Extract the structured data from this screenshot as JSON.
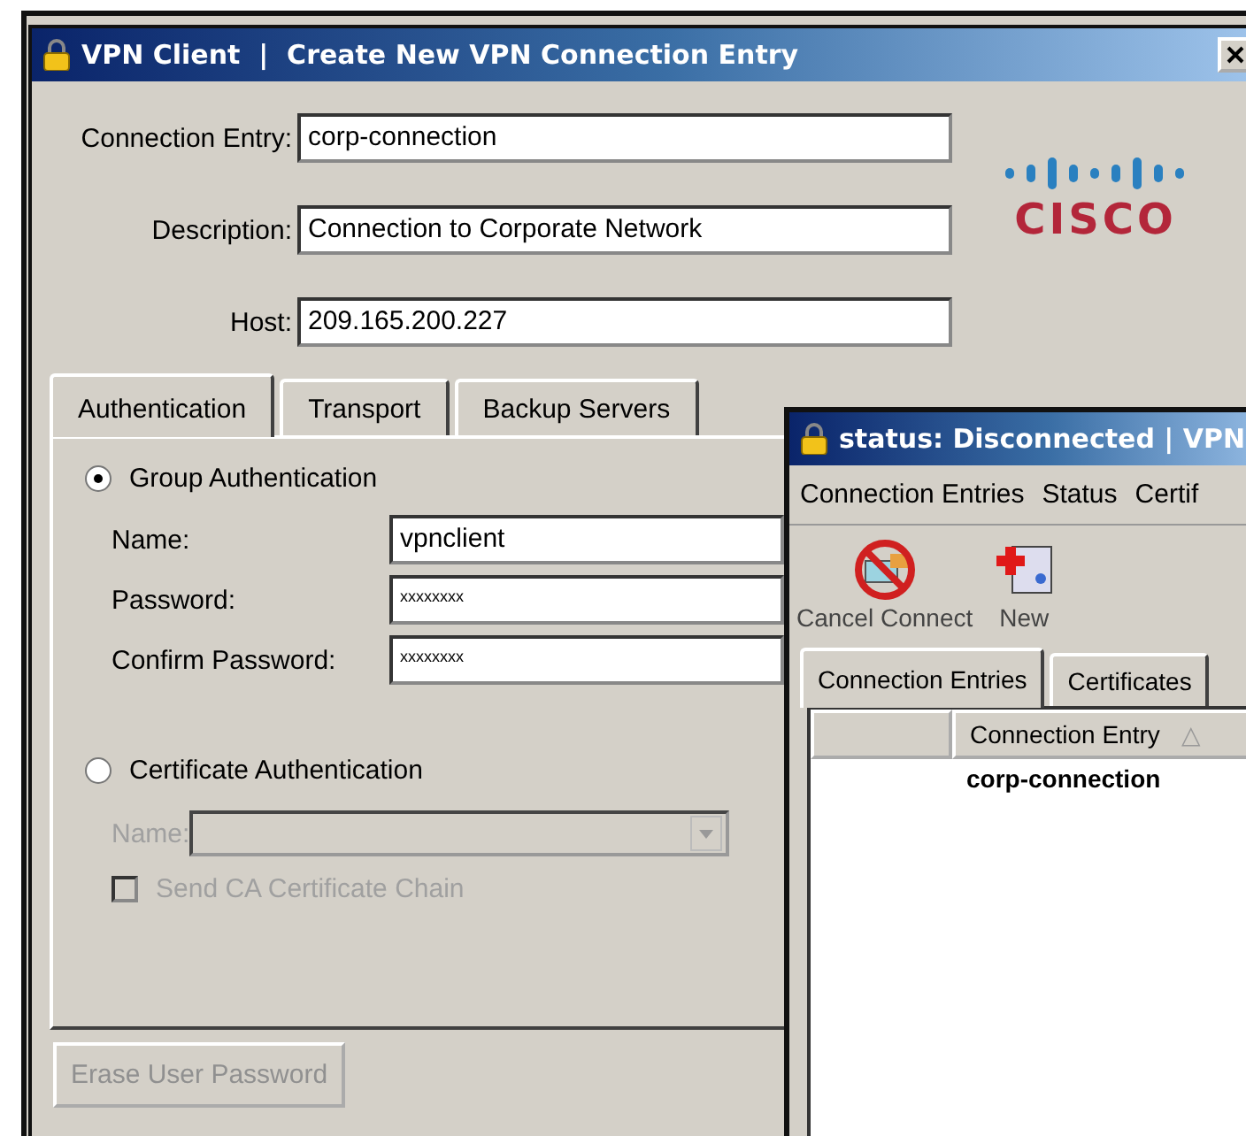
{
  "dialog": {
    "title": "VPN Client  |  Create New VPN Connection Entry",
    "fields": [
      {
        "label": "Connection Entry:",
        "value": "corp-connection"
      },
      {
        "label": "Description:",
        "value": "Connection to Corporate Network"
      },
      {
        "label": "Host:",
        "value": "209.165.200.227"
      }
    ],
    "logo_text": "CISCO",
    "tabs": [
      {
        "label": "Authentication",
        "selected": true
      },
      {
        "label": "Transport",
        "selected": false
      },
      {
        "label": "Backup Servers",
        "selected": false
      }
    ],
    "auth_options": [
      {
        "label": "Group Authentication",
        "selected": true,
        "disabled": false,
        "fields": [
          {
            "label": "Name:",
            "value": "vpnclient",
            "kind": "text"
          },
          {
            "label": "Password:",
            "value": "xxxxxxxx",
            "kind": "password"
          },
          {
            "label": "Confirm Password:",
            "value": "xxxxxxxx",
            "kind": "password"
          }
        ]
      },
      {
        "label": "Certificate Authentication",
        "selected": false,
        "disabled": true,
        "fields": [
          {
            "label": "Name:",
            "kind": "combo"
          },
          {
            "label": "Send CA Certificate Chain",
            "kind": "checkbox",
            "checked": false
          }
        ]
      }
    ],
    "buttons": [
      {
        "label": "Erase User Password",
        "disabled": true
      }
    ]
  },
  "status_window": {
    "title": "status: Disconnected | VPN",
    "menu": [
      "Connection Entries",
      "Status",
      "Certif"
    ],
    "toolbar": [
      {
        "label": "Cancel Connect",
        "kind": "cancel"
      },
      {
        "label": "New",
        "kind": "new"
      }
    ],
    "tabs": [
      {
        "label": "Connection Entries",
        "selected": true
      },
      {
        "label": "Certificates",
        "selected": false
      }
    ],
    "table": {
      "columns": [
        {
          "label": "Connection Entry",
          "sort_mark": "△"
        }
      ],
      "rows": [
        {
          "connection_entry": "corp-connection"
        }
      ]
    }
  }
}
